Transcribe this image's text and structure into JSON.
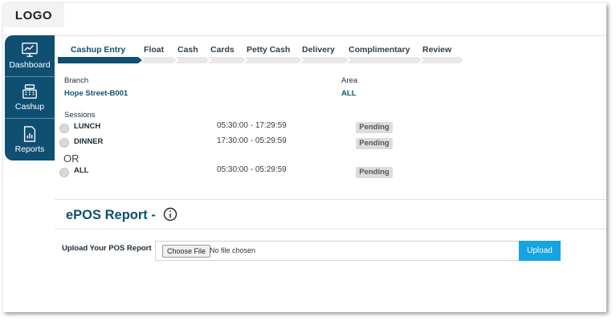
{
  "logo": {
    "text": "LOGO"
  },
  "sidebar": {
    "items": [
      {
        "label": "Dashboard",
        "icon": "dashboard-icon"
      },
      {
        "label": "Cashup",
        "icon": "cash-register-icon"
      },
      {
        "label": "Reports",
        "icon": "report-icon"
      }
    ]
  },
  "tabs": {
    "active": "Cashup Entry",
    "items": [
      "Cashup Entry",
      "Float",
      "Cash",
      "Cards",
      "Petty Cash",
      "Delivery",
      "Complimentary",
      "Review"
    ]
  },
  "branch": {
    "label": "Branch",
    "value": "Hope Street-B001"
  },
  "area": {
    "label": "Area",
    "value": "ALL"
  },
  "sessions": {
    "label": "Sessions",
    "or_text": "OR",
    "rows": [
      {
        "name": "LUNCH",
        "time": "05:30:00 - 17:29:59",
        "status": "Pending"
      },
      {
        "name": "DINNER",
        "time": "17:30:00 - 05:29:59",
        "status": "Pending"
      },
      {
        "name": "ALL",
        "time": "05:30:00 - 05:29:59",
        "status": "Pending"
      }
    ]
  },
  "epos": {
    "title": "ePOS Report -",
    "info_icon": "info-icon",
    "upload_label": "Upload Your POS Report",
    "choose_file_label": "Choose File",
    "no_file_text": "No file chosen",
    "upload_button": "Upload"
  },
  "colors": {
    "brand": "#0f4f72",
    "upload": "#16a3e0",
    "badge_bg": "#dcdcdc",
    "tab_track": "#e8e8e8"
  }
}
